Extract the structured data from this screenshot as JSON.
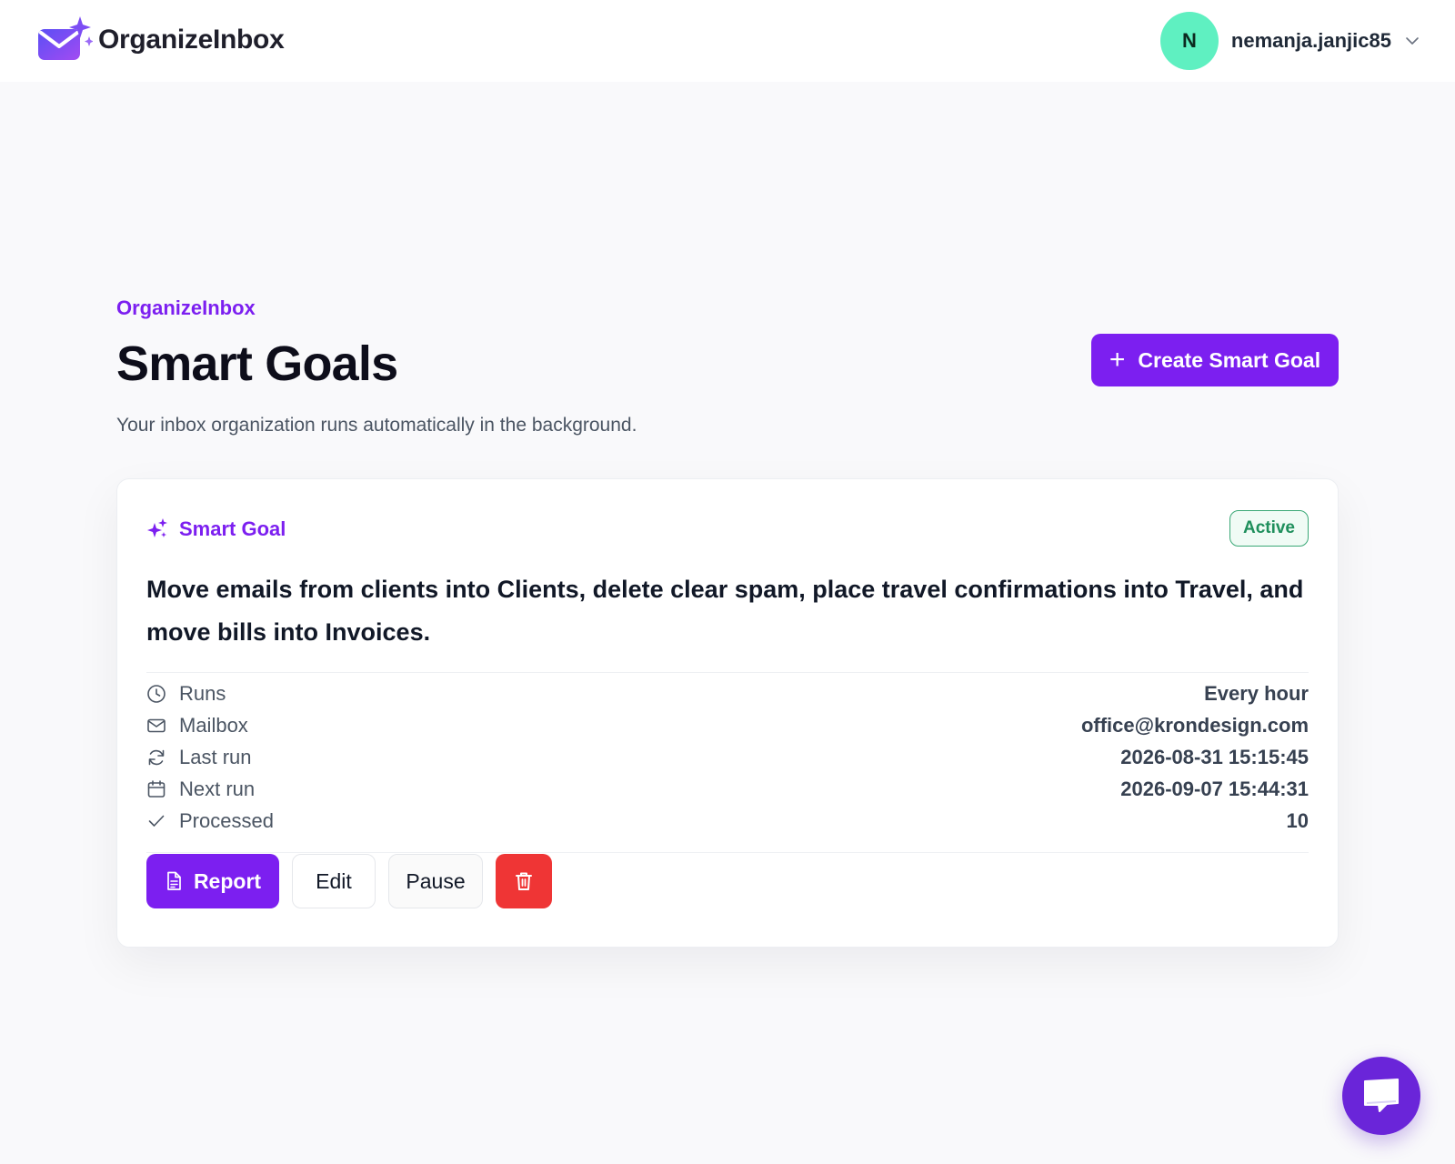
{
  "brand": {
    "name": "OrganizeInbox"
  },
  "user": {
    "initial": "N",
    "name": "nemanja.janjic85"
  },
  "page": {
    "eyebrow": "OrganizeInbox",
    "title": "Smart Goals",
    "subtitle": "Your inbox organization runs automatically in the background.",
    "create_label": "Create Smart Goal"
  },
  "goal": {
    "kind_label": "Smart Goal",
    "status": "Active",
    "text": "Move emails from clients into Clients, delete clear spam, place travel confirmations into Travel, and move bills into Invoices.",
    "details": [
      {
        "icon": "clock-icon",
        "label": "Runs",
        "value": "Every hour"
      },
      {
        "icon": "mail-icon",
        "label": "Mailbox",
        "value": "office@krondesign.com"
      },
      {
        "icon": "refresh-icon",
        "label": "Last run",
        "value": "2026-08-31 15:15:45"
      },
      {
        "icon": "calendar-icon",
        "label": "Next run",
        "value": "2026-09-07 15:44:31"
      },
      {
        "icon": "check-icon",
        "label": "Processed",
        "value": "10"
      }
    ],
    "actions": {
      "report": "Report",
      "edit": "Edit",
      "pause": "Pause"
    }
  },
  "colors": {
    "accent": "#7c1ff0",
    "avatar": "#5ff0c1",
    "active_status": "#1f8f5c",
    "danger": "#ef3535",
    "chat": "#6a25d9"
  }
}
